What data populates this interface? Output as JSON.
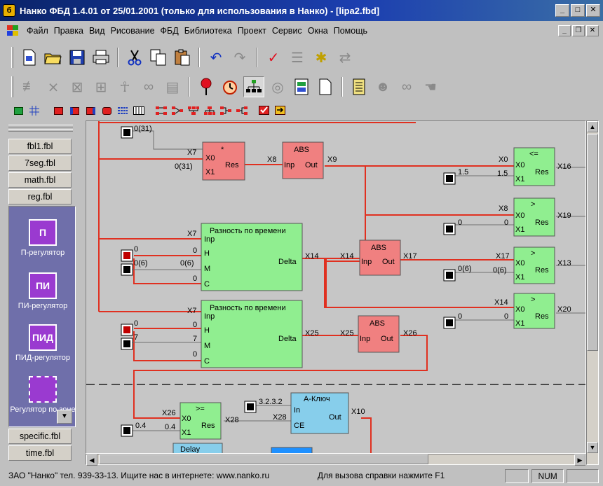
{
  "window": {
    "title": "Нанко ФБД 1.4.01 от 25/01.2001 (только для использования в Нанко) - [lipa2.fbd]",
    "app_icon": "б"
  },
  "menu": [
    "Файл",
    "Правка",
    "Вид",
    "Рисование",
    "ФБД",
    "Библиотека",
    "Проект",
    "Сервис",
    "Окна",
    "Помощь"
  ],
  "icons": {
    "toolbar1": [
      "new-doc-icon",
      "open-folder-icon",
      "save-icon",
      "print-icon",
      "cut-icon",
      "copy-icon",
      "paste-icon",
      "undo-icon",
      "redo-icon",
      "check-icon",
      "compile-icon",
      "debug-bug-icon",
      "sync-icon"
    ],
    "toolbar2": [
      "block-tool-1-icon",
      "block-tool-2-icon",
      "block-tool-3-icon",
      "block-tool-4-icon",
      "block-tool-5-icon",
      "block-tool-6-icon",
      "block-tool-7-icon",
      "stop-icon",
      "alarm-clock-icon",
      "network-icon",
      "cd-icon",
      "report-icon",
      "page-icon",
      "list-icon",
      "head-icon",
      "glasses-icon",
      "hand-icon"
    ]
  },
  "colors": {
    "block_red": "#f08080",
    "block_green": "#90ee90",
    "block_blue": "#87ceeb",
    "wire_red": "#e03020",
    "palette_bg": "#6f6faa"
  },
  "library_tabs": [
    "fbl1.fbl",
    "7seg.fbl",
    "math.fbl",
    "reg.fbl"
  ],
  "library_tabs_bottom": [
    "specific.fbl",
    "time.fbl"
  ],
  "palette": [
    {
      "icon": "П",
      "label": "П-регулятор"
    },
    {
      "icon": "ПИ",
      "label": "ПИ-регулятор"
    },
    {
      "icon": "ПИД",
      "label": "ПИД-регулятор"
    },
    {
      "icon": "",
      "label": "Регулятор по зоне"
    }
  ],
  "diagram": {
    "const_top": "0(31)",
    "block1": {
      "title": "*",
      "in0": "X0",
      "in1": "X1",
      "out": "Res",
      "lbl_in0": "X7",
      "lbl_in1": "0(31)"
    },
    "abs1": {
      "title": "ABS",
      "in": "Inp",
      "out": "Out",
      "lbl_in": "X8",
      "lbl_out": "X9",
      "lbl_left": "X8"
    },
    "cmp1": {
      "title": "<=",
      "in0": "X0",
      "in1": "X1",
      "out": "Res",
      "lbl_in0": "X0",
      "lbl_in1": "1.5",
      "lbl_out": "X16",
      "const": "1.5"
    },
    "cmp2": {
      "title": ">",
      "in0": "X0",
      "in1": "X1",
      "out": "Res",
      "lbl_in0": "X8",
      "lbl_in1": "0",
      "lbl_out": "X19",
      "const": "0"
    },
    "diff1": {
      "title": "Разность по времени",
      "pins": [
        "Inp",
        "H",
        "M",
        "C"
      ],
      "out": "Delta",
      "lbl_inp": "X7",
      "lbl_h": "0",
      "lbl_m": "0(6)",
      "lbl_c": "0",
      "const_h": "0",
      "const_m": "0(6)",
      "lbl_out": "X14"
    },
    "abs2": {
      "title": "ABS",
      "in": "Inp",
      "out": "Out",
      "lbl_in": "X14",
      "lbl_out": "X17"
    },
    "cmp3": {
      "title": ">",
      "in0": "X0",
      "in1": "X1",
      "out": "Res",
      "lbl_in0": "X17",
      "lbl_in1": "0(6)",
      "lbl_out": "X13",
      "const": "0(6)"
    },
    "cmp4": {
      "title": ">",
      "in0": "X0",
      "in1": "X1",
      "out": "Res",
      "lbl_in0": "X14",
      "lbl_in1": "0",
      "lbl_out": "X20",
      "const": "0"
    },
    "diff2": {
      "title": "Разность по времени",
      "pins": [
        "Inp",
        "H",
        "M",
        "C"
      ],
      "out": "Delta",
      "lbl_inp": "X7",
      "lbl_h": "0",
      "lbl_m": "7",
      "lbl_c": "0",
      "const_h": "0",
      "const_m": "7",
      "lbl_out": "X25"
    },
    "abs3": {
      "title": "ABS",
      "in": "Inp",
      "out": "Out",
      "lbl_in": "X25",
      "lbl_out": "X26"
    },
    "cmp5": {
      "title": ">=",
      "in0": "X0",
      "in1": "X1",
      "out": "Res",
      "lbl_in0": "X26",
      "lbl_in1": "0.4",
      "lbl_out": "X28",
      "const": "0.4"
    },
    "key": {
      "title": "А-Ключ",
      "in": "In",
      "ce": "CE",
      "out": "Out",
      "lbl_in": "X26",
      "lbl_ce": "X28",
      "lbl_out": "X10",
      "const": "3.2.3.2"
    },
    "partial_block": "Delay"
  },
  "statusbar": {
    "company": "ЗАО \"Нанко\" тел. 939-33-13. Ищите нас в интернете: www.nanko.ru",
    "help": "Для вызова справки нажмите F1",
    "num": "NUM"
  }
}
